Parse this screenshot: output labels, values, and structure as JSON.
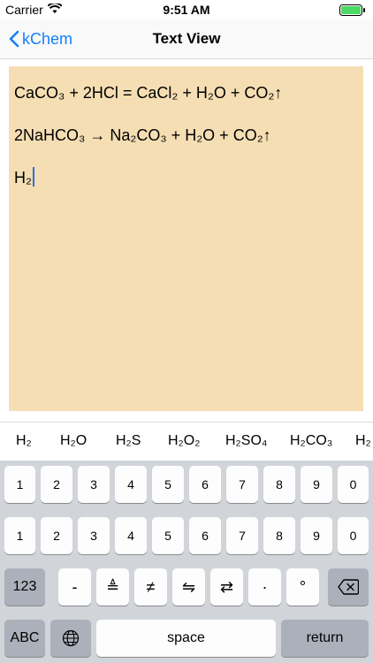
{
  "status_bar": {
    "carrier": "Carrier",
    "time": "9:51 AM"
  },
  "nav": {
    "back_label": "kChem",
    "title": "Text View"
  },
  "text_view": {
    "lines": [
      "CaCO₃ + 2HCl = CaCl₂ + H₂O + CO₂↑",
      "2NaHCO₃ → Na₂CO₃ + H₂O + CO₂↑",
      "H₂"
    ],
    "background": "#f5deb3"
  },
  "suggestions": [
    "H₂",
    "H₂O",
    "H₂S",
    "H₂O₂",
    "H₂SO₄",
    "H₂CO₃",
    "H₂"
  ],
  "keyboard": {
    "row1": [
      "1",
      "2",
      "3",
      "4",
      "5",
      "6",
      "7",
      "8",
      "9",
      "0"
    ],
    "row2": [
      "1",
      "2",
      "3",
      "4",
      "5",
      "6",
      "7",
      "8",
      "9",
      "0"
    ],
    "row3": {
      "mode": "123",
      "keys": [
        "-",
        "≜",
        "≠",
        "⇋",
        "⇄",
        "·",
        "°"
      ],
      "delete_icon": "backspace-icon"
    },
    "row4": {
      "abc": "ABC",
      "globe_icon": "globe-icon",
      "space": "space",
      "return": "return"
    }
  },
  "colors": {
    "accent": "#147efb",
    "keyboard_bg": "#d1d4d9"
  }
}
